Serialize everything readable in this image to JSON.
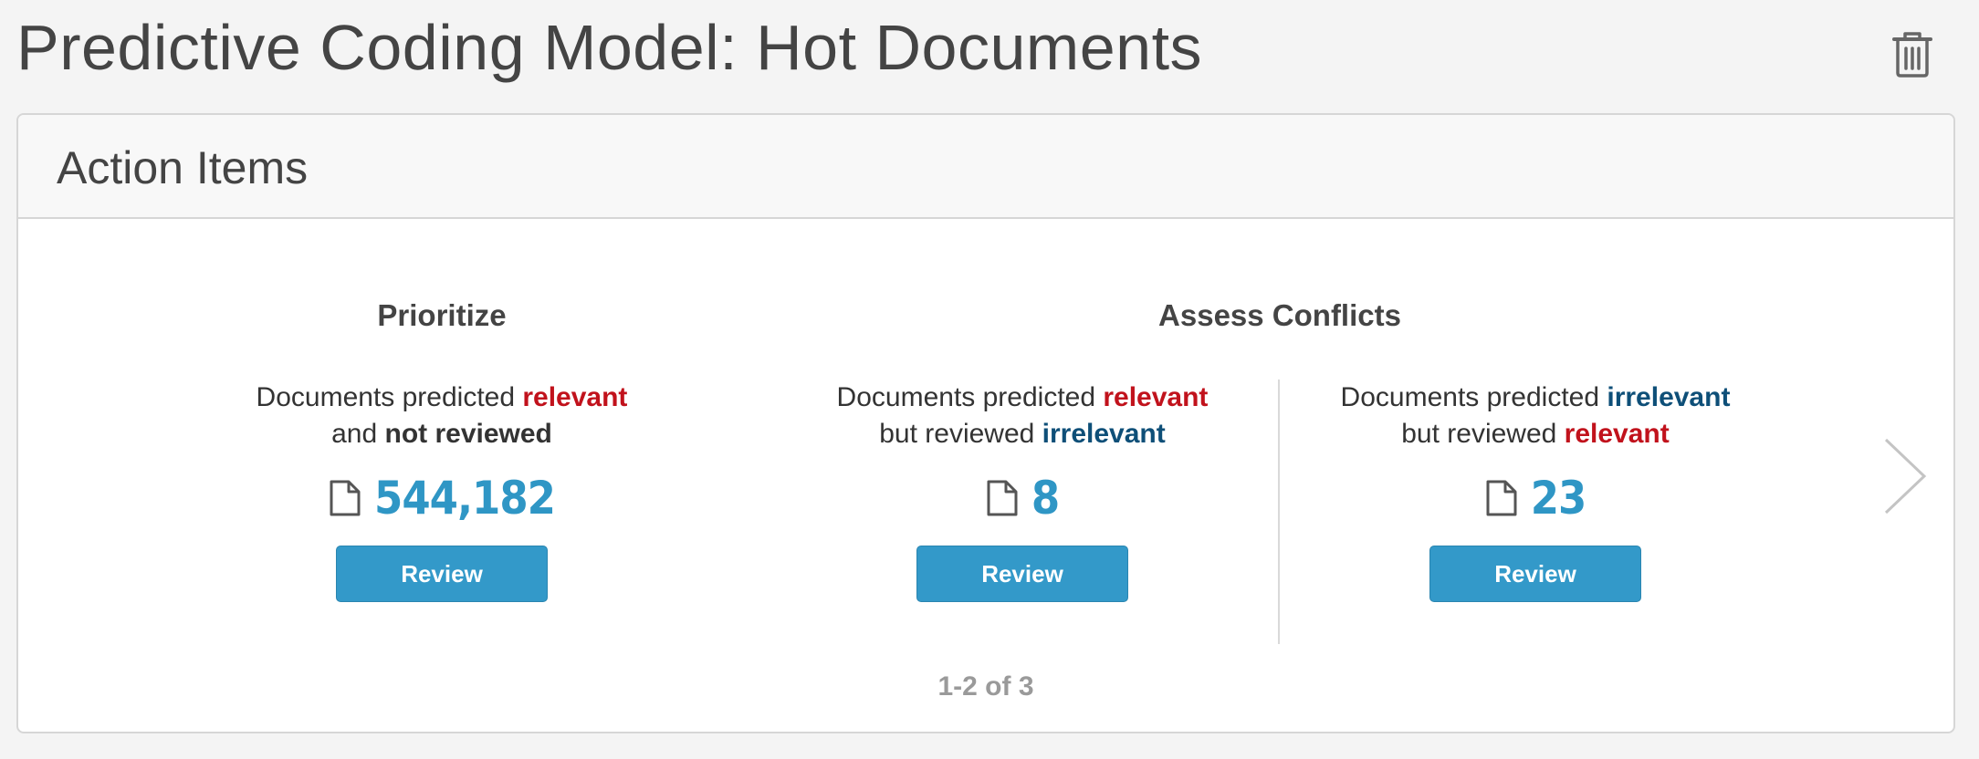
{
  "page": {
    "title": "Predictive Coding Model: Hot Documents"
  },
  "panel": {
    "title": "Action Items"
  },
  "sections": {
    "prioritize": {
      "title": "Prioritize"
    },
    "assess_conflicts": {
      "title": "Assess Conflicts"
    }
  },
  "items": [
    {
      "desc_pre": "Documents predicted ",
      "desc_key1": "relevant",
      "desc_mid": "and ",
      "desc_key2": "not reviewed",
      "count": "544,182",
      "button": "Review"
    },
    {
      "desc_pre": "Documents predicted ",
      "desc_key1": "relevant",
      "desc_mid": "but reviewed ",
      "desc_key2": "irrelevant",
      "count": "8",
      "button": "Review"
    },
    {
      "desc_pre": "Documents predicted ",
      "desc_key1": "irrelevant",
      "desc_mid": "but reviewed ",
      "desc_key2": "relevant",
      "count": "23",
      "button": "Review"
    }
  ],
  "pagination": {
    "label": "1-2 of 3"
  },
  "icons": {
    "delete": "trash-icon",
    "document": "document-icon",
    "next": "chevron-right-icon"
  },
  "colors": {
    "relevant": "#c1121c",
    "irrelevant": "#0e4f78",
    "count": "#2f96c5",
    "button": "#3399c9"
  }
}
